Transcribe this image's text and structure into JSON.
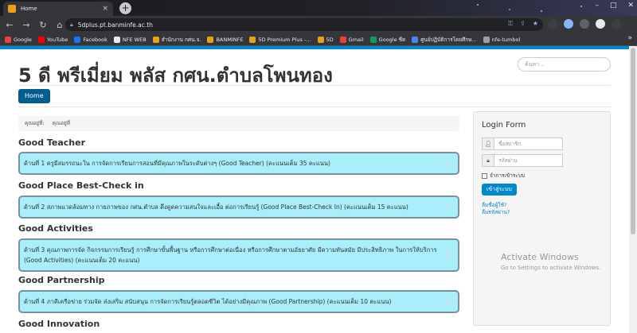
{
  "browser": {
    "tab_title": "Home",
    "tab_close": "×",
    "new_tab": "+",
    "window_controls": [
      "–",
      "□",
      "✕"
    ],
    "url": "5dplus.pt.banminfe.ac.th",
    "bookmarks": [
      {
        "label": "Google",
        "color": "#e8453c"
      },
      {
        "label": "YouTube",
        "color": "#ff0000"
      },
      {
        "label": "Facebook",
        "color": "#1877f2"
      },
      {
        "label": "NFE WEB",
        "color": "#e8eaed"
      },
      {
        "label": "สำนักงาน กศน.จ.",
        "color": "#e8a21a"
      },
      {
        "label": "BANMINFE",
        "color": "#e8a21a"
      },
      {
        "label": "5D Premium Plus -...",
        "color": "#e8a21a"
      },
      {
        "label": "5D",
        "color": "#e8a21a"
      },
      {
        "label": "Gmail",
        "color": "#ea4335"
      },
      {
        "label": "Google ชีต",
        "color": "#0f9d58"
      },
      {
        "label": "ศูนย์ปฏิบัติการโดยศึกษ...",
        "color": "#4285f4"
      },
      {
        "label": "nfe-tumbol",
        "color": "#9aa0a6"
      }
    ]
  },
  "page": {
    "site_title": "5 ดี พรีเมี่ยม พลัส กศน.ตำบลโพนทอง",
    "search_placeholder": "ค้นหา...",
    "nav_home": "Home",
    "breadcrumb": [
      "คุณอยู่ที่:",
      "คุณอยู่ที่"
    ],
    "sections": [
      {
        "title": "Good Teacher",
        "text": "ด้านที่ 1 ครูมีสมรรถนะใน การจัดการเรียนการสอนที่มีคุณภาพในระดับต่างๆ (Good Teacher) (คะแนนเต็ม 35 คะแนน)"
      },
      {
        "title": "Good Place Best-Check in",
        "text": "ด้านที่ 2 สภาพแวดล้อมทาง กายภาพของ กศน.ตำบล ดึงดูดความสนใจและเอื้อ ต่อการเรียนรู้ (Good Place Best-Check In) (คะแนนเต็ม 15 คะแนน)"
      },
      {
        "title": "Good Activities",
        "text": "ด้านที่ 3 คุณภาพการจัด กิจกรรมการเรียนรู้ การศึกษาขั้นพื้นฐาน หรือการศึกษาต่อเนื่อง หรือการศึกษาตามอัธยาศัย มีความทันสมัย มีประสิทธิภาพ ในการให้บริการ (Good Activities) (คะแนนเต็ม 20 คะแนน)"
      },
      {
        "title": "Good Partnership",
        "text": "ด้านที่ 4 ภาคีเครือข่าย ร่วมจัด ส่งเสริม สนับสนุน การจัดการเรียนรู้ตลอดชีวิต ได้อย่างมีคุณภาพ (Good Partnership) (คะแนนเต็ม 10 คะแนน)"
      },
      {
        "title": "Good Innovation",
        "text": ""
      }
    ],
    "plus_symbol": "+",
    "login": {
      "title": "Login Form",
      "username_placeholder": "ชื่อสมาชิก",
      "password_placeholder": "รหัสผ่าน",
      "remember_label": "จำการเข้าระบบ",
      "login_button": "เข้าสู่ระบบ",
      "forgot_username": "ลืมชื่อผู้ใช้?",
      "forgot_password": "ลืมรหัสผ่าน?"
    },
    "watermark": {
      "line1": "Activate Windows",
      "line2": "Go to Settings to activate Windows."
    }
  }
}
